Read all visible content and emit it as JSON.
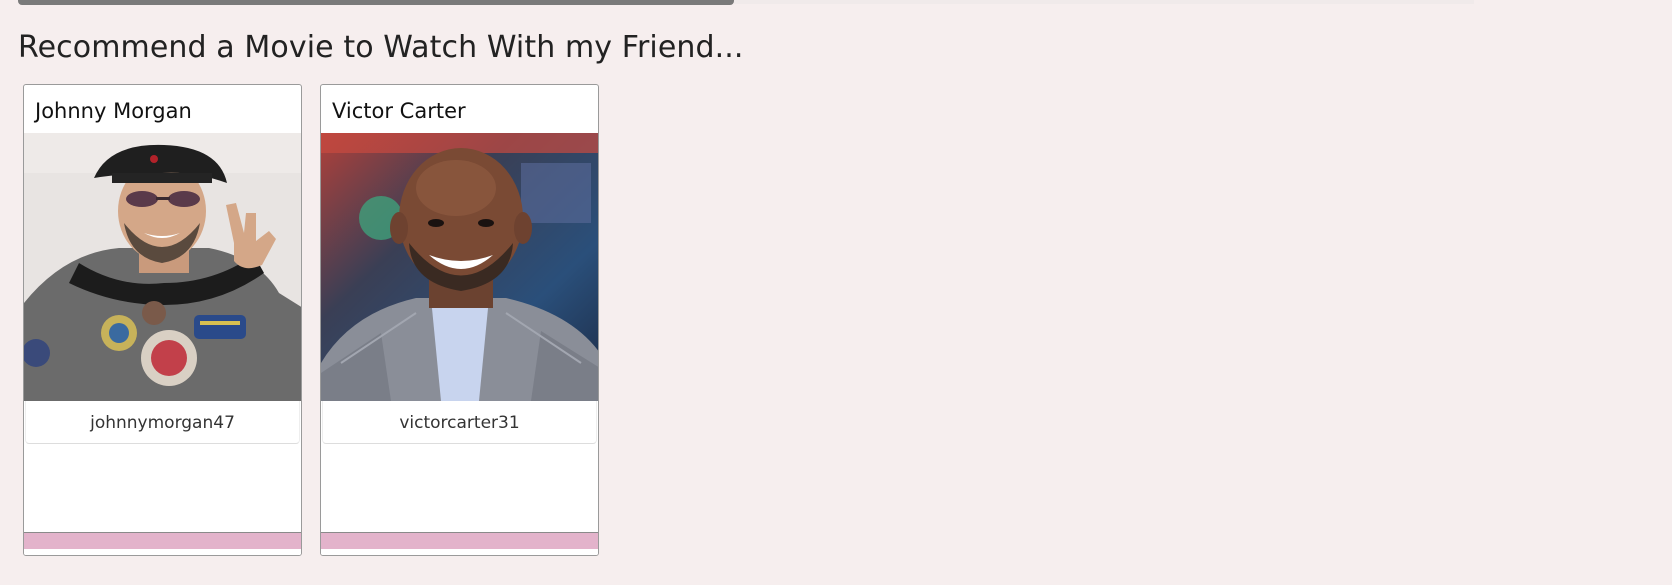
{
  "page": {
    "title": "Recommend a Movie to Watch With my Friend..."
  },
  "friends": [
    {
      "name": "Johnny Morgan",
      "username": "johnnymorgan47"
    },
    {
      "name": "Victor Carter",
      "username": "victorcarter31"
    }
  ],
  "colors": {
    "background": "#f6eeee",
    "card_footer": "#e3b3cb",
    "scroll_bar": "#7a7a7a"
  }
}
